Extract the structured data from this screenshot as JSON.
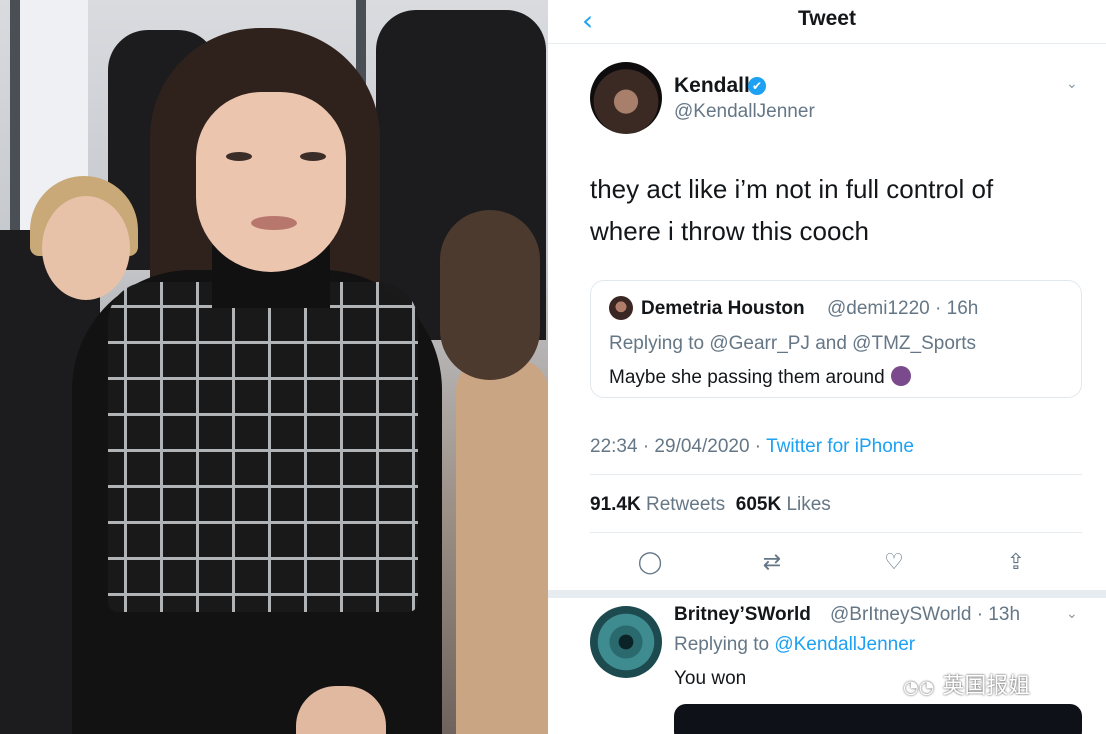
{
  "tweet": {
    "nav_back": "‹",
    "nav_title": "Tweet",
    "author": {
      "name": "Kendall",
      "handle": "@KendallJenner",
      "verified_icon": "✔"
    },
    "caret": "⌄",
    "text": "they act like i’m not in full control of where i throw this cooch",
    "quote": {
      "name": "Demetria Houston",
      "handle": "@demi1220 · 16h",
      "replying": "Replying to @Gearr_PJ and @TMZ_Sports",
      "text": "Maybe she passing them around"
    },
    "meta": {
      "time": "22:34 · 29/04/2020 · ",
      "source": "Twitter for iPhone"
    },
    "counts": {
      "retweets_num": "91.4K",
      "retweets_label": "Retweets",
      "likes_num": "605K",
      "likes_label": "Likes"
    },
    "actions": {
      "reply": "◯",
      "retweet": "⇄",
      "like": "♡",
      "share": "⇪"
    }
  },
  "reply": {
    "name": "Britney’SWorld",
    "handle": "@BrItneySWorld · 13h",
    "replying_prefix": "Replying to ",
    "replying_handle": "@KendallJenner",
    "text": "You won"
  },
  "watermark": {
    "icon": "◔◔",
    "text": "英国报姐"
  },
  "colors": {
    "link": "#1da1f2",
    "muted": "#657786",
    "text": "#14171a"
  }
}
